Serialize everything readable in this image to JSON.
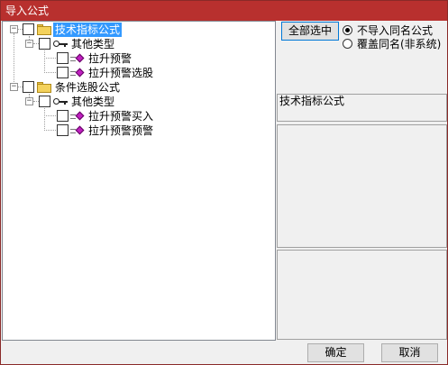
{
  "window": {
    "title": "导入公式"
  },
  "tree": {
    "root1": {
      "label": "技术指标公式",
      "expander": "−"
    },
    "group1": {
      "label": "其他类型",
      "expander": "−"
    },
    "items1": [
      {
        "label": "拉升预警"
      },
      {
        "label": "拉升预警选股"
      }
    ],
    "root2": {
      "label": "条件选股公式",
      "expander": "−"
    },
    "group2": {
      "label": "其他类型",
      "expander": "−"
    },
    "items2": [
      {
        "label": "拉升预警买入"
      },
      {
        "label": "拉升预警预警"
      }
    ]
  },
  "right": {
    "select_all_label": "全部选中",
    "options": [
      {
        "label": "不导入同名公式",
        "checked": true
      },
      {
        "label": "覆盖同名(非系统)",
        "checked": false
      }
    ],
    "info_text": "技术指标公式"
  },
  "footer": {
    "ok_label": "确定",
    "cancel_label": "取消"
  }
}
